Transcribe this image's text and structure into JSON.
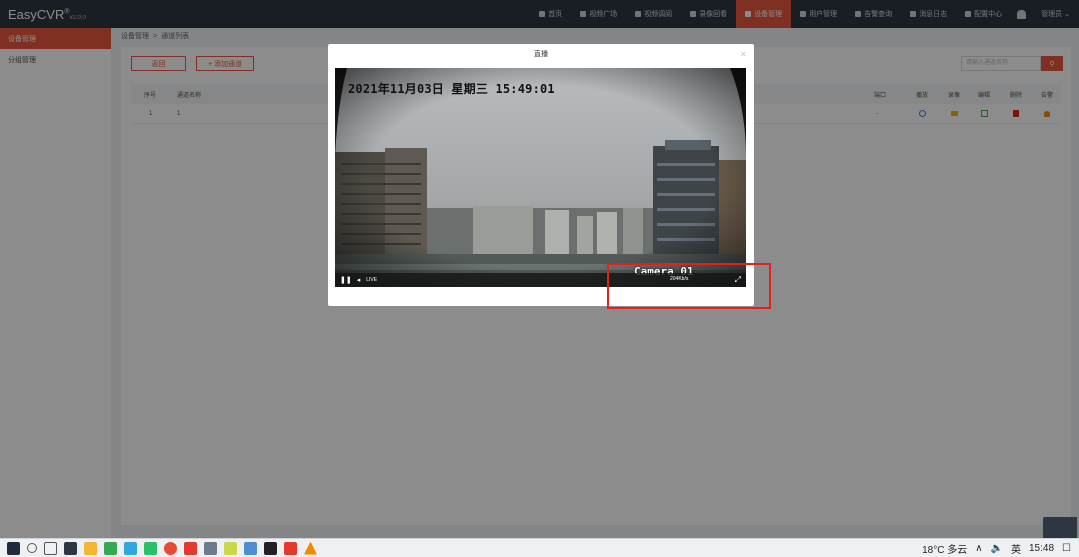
{
  "app": {
    "name": "EasyCVR",
    "sup": "®",
    "version": "v2.0.0"
  },
  "nav": [
    {
      "label": "首页",
      "icon": "home-icon"
    },
    {
      "label": "视频广场",
      "icon": "grid-icon"
    },
    {
      "label": "视频调阅",
      "icon": "playlist-icon"
    },
    {
      "label": "录像回看",
      "icon": "record-icon"
    },
    {
      "label": "设备管理",
      "icon": "device-icon",
      "active": true
    },
    {
      "label": "用户管理",
      "icon": "user-icon"
    },
    {
      "label": "告警查询",
      "icon": "alarm-icon"
    },
    {
      "label": "消息日志",
      "icon": "bell-icon"
    },
    {
      "label": "配置中心",
      "icon": "gear-icon"
    }
  ],
  "user": {
    "name": "管理员 ⌄"
  },
  "sidebar": [
    {
      "label": "设备管理",
      "active": true
    },
    {
      "label": "分组管理",
      "active": false
    }
  ],
  "breadcrumb": {
    "first": "设备管理",
    "sep": ">",
    "second": "通道列表"
  },
  "toolbar": {
    "back_label": "返回",
    "add_label": "+ 添加通道",
    "search_placeholder": "请输入通道名称",
    "search_icon": "search-icon"
  },
  "table": {
    "headers": {
      "index": "序号",
      "name": "通道名称",
      "port": "端口",
      "play": "播放",
      "record": "录像",
      "edit": "编辑",
      "delete": "删除",
      "alarm": "告警"
    },
    "rows": [
      {
        "index": "1",
        "name": "1",
        "port": "-"
      }
    ]
  },
  "modal": {
    "title": "直播",
    "close": "×",
    "timestamp": "2021年11月03日  星期三  15:49:01",
    "camera": "Camera 01",
    "pause": "❚❚",
    "volume": "◂",
    "live": "LIVE",
    "rate": "204Kb/s",
    "fullscreen": "⤢"
  },
  "taskbar": {
    "weather": "18°C 多云",
    "ime": "英",
    "time": "15:48",
    "tray_arrow": "∧",
    "volume": "🔈",
    "notify": "☐"
  },
  "colors": {
    "accent": "#e8583f",
    "topbar": "#2f3643",
    "highlight": "#e0221a"
  }
}
